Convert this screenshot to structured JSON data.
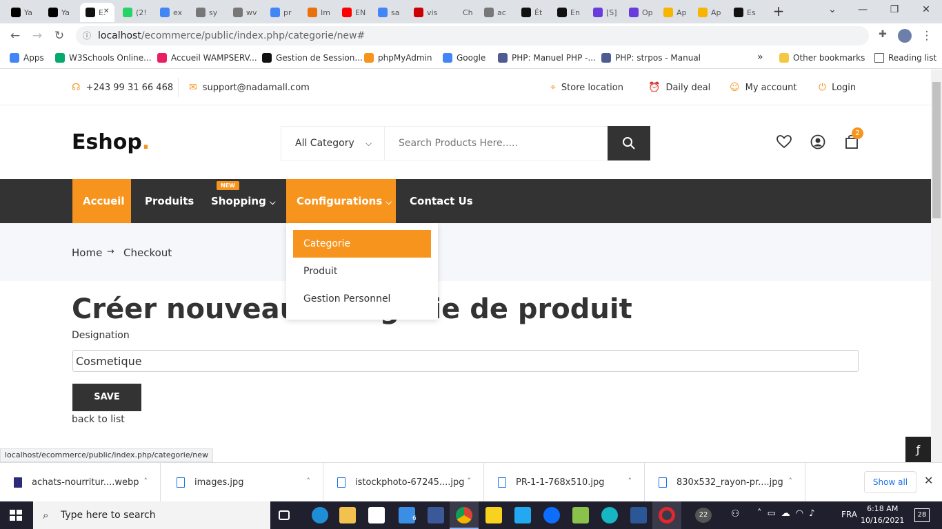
{
  "browser": {
    "tabs": [
      {
        "label": "Ya",
        "color": "#000"
      },
      {
        "label": "Ya",
        "color": "#000"
      },
      {
        "label": "E.",
        "color": "#111",
        "active": true
      },
      {
        "label": "(2!",
        "color": "#25d366"
      },
      {
        "label": "ex",
        "color": "#4285f4"
      },
      {
        "label": "sy",
        "color": "#777"
      },
      {
        "label": "wv",
        "color": "#777"
      },
      {
        "label": "pr",
        "color": "#4285f4"
      },
      {
        "label": "Im",
        "color": "#e8710a"
      },
      {
        "label": "EN",
        "color": "#ff0000"
      },
      {
        "label": "sa",
        "color": "#4285f4"
      },
      {
        "label": "vis",
        "color": "#c00"
      },
      {
        "label": "Ch",
        "color": "#dee1e6"
      },
      {
        "label": "ac",
        "color": "#777"
      },
      {
        "label": "Ét",
        "color": "#111"
      },
      {
        "label": "En",
        "color": "#111"
      },
      {
        "label": "[S]",
        "color": "#6a3cdb"
      },
      {
        "label": "Op",
        "color": "#6a3cdb"
      },
      {
        "label": "Ap",
        "color": "#f7b500"
      },
      {
        "label": "Ap",
        "color": "#f7b500"
      },
      {
        "label": "Es",
        "color": "#111"
      }
    ],
    "new_tab": "+",
    "url_host": "localhost",
    "url_path": "/ecommerce/public/index.php/categorie/new#",
    "bookmarks": [
      {
        "label": "Apps",
        "color": "#4285f4"
      },
      {
        "label": "W3Schools Online...",
        "color": "#04aa6d"
      },
      {
        "label": "Accueil WAMPSERV...",
        "color": "#e91e63"
      },
      {
        "label": "Gestion de Session...",
        "color": "#111"
      },
      {
        "label": "phpMyAdmin",
        "color": "#f7941d"
      },
      {
        "label": "Google",
        "color": "#4285f4"
      },
      {
        "label": "PHP: Manuel PHP -...",
        "color": "#4f5b93"
      },
      {
        "label": "PHP: strpos - Manual",
        "color": "#4f5b93"
      }
    ],
    "other_bookmarks": "Other bookmarks",
    "reading_list": "Reading list",
    "bookmark_overflow": "»"
  },
  "topbar": {
    "phone": "+243 99 31 66 468",
    "email": "support@nadamall.com",
    "store_location": "Store location",
    "daily_deal": "Daily deal",
    "my_account": "My account",
    "login": "Login"
  },
  "header": {
    "logo": "Eshop",
    "logo_dot": ".",
    "category_select": "All Category",
    "search_placeholder": "Search Products Here.....",
    "cart_count": "2"
  },
  "nav": {
    "items": [
      "Accueil",
      "Produits",
      "Shopping",
      "Configurations",
      "Contact Us"
    ],
    "new_badge": "NEW",
    "dropdown": [
      "Categorie",
      "Produit",
      "Gestion Personnel"
    ]
  },
  "breadcrumb": {
    "home": "Home",
    "arrow": "→",
    "current": "Checkout"
  },
  "form": {
    "title": "Créer nouveau Categorie de produit",
    "label": "Designation",
    "value": "Cosmetique",
    "save": "SAVE",
    "back": "back to list"
  },
  "status_url": "localhost/ecommerce/public/index.php/categorie/new",
  "downloads": {
    "items": [
      "achats-nourritur....webp",
      "images.jpg",
      "istockphoto-67245....jpg",
      "PR-1-1-768x510.jpg",
      "830x532_rayon-pr....jpg"
    ],
    "show_all": "Show all"
  },
  "taskbar": {
    "search": "Type here to search",
    "time": "6:18 AM",
    "date": "10/16/2021",
    "lang": "FRA",
    "notif_count": "28",
    "temp": "22",
    "mail_count": "6"
  }
}
